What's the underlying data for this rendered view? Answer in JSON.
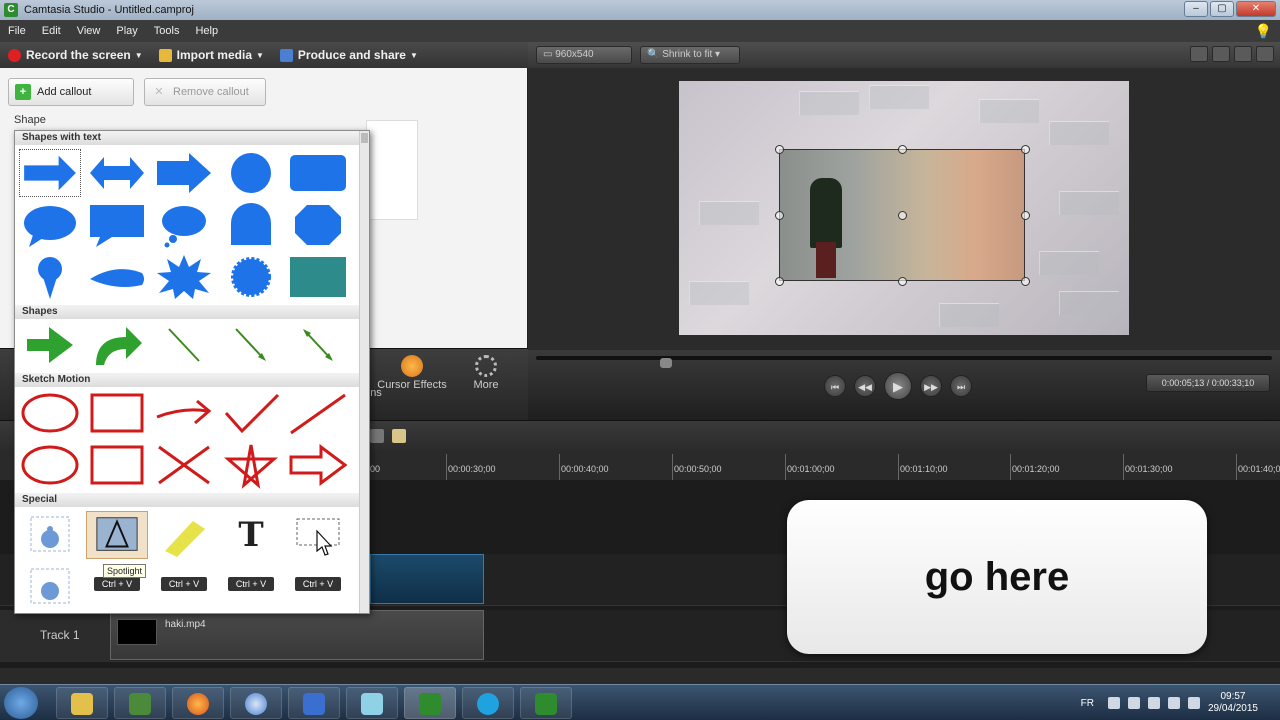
{
  "window": {
    "title": "Camtasia Studio - Untitled.camproj",
    "app_icon": "C",
    "controls": [
      "–",
      "▢",
      "✕"
    ]
  },
  "menu": [
    "File",
    "Edit",
    "View",
    "Play",
    "Tools",
    "Help"
  ],
  "toolbar": {
    "record": "Record the screen",
    "import": "Import media",
    "produce": "Produce and share"
  },
  "callouts": {
    "add": "Add callout",
    "remove": "Remove callout",
    "shape_label": "Shape"
  },
  "gallery": {
    "sections": [
      "Shapes with text",
      "Shapes",
      "Sketch Motion",
      "Special"
    ],
    "tooltip": "Spotlight",
    "special_text_glyph": "T",
    "key_label": "Ctrl + V"
  },
  "tasks": [
    {
      "label": "Cursor Effects",
      "icon": "cursor-effects-icon"
    },
    {
      "label": "More",
      "icon": "more-icon"
    }
  ],
  "task_partial": "ns",
  "preview": {
    "dimensions": "960x540",
    "zoom": "Shrink to fit",
    "timecode": "0:00:05;13 / 0:00:33;10"
  },
  "timeline": {
    "ticks": [
      "00:00:30;00",
      "00:00:40;00",
      "00:00:50;00",
      "00:01:00;00",
      "00:01:10;00",
      "00:01:20;00",
      "00:01:30;00",
      "00:01:40;00"
    ],
    "partial_tick": "00",
    "track_label": "Track 1",
    "clip_name": "haki.mp4"
  },
  "overlay_text": "go here",
  "taskbar": {
    "language": "FR",
    "time": "09:57",
    "date": "29/04/2015"
  },
  "colors": {
    "shape_blue": "#1e73e8",
    "sketch_red": "#d11a1a",
    "shape_green": "#2fa12f",
    "teal": "#2e8b8b"
  }
}
